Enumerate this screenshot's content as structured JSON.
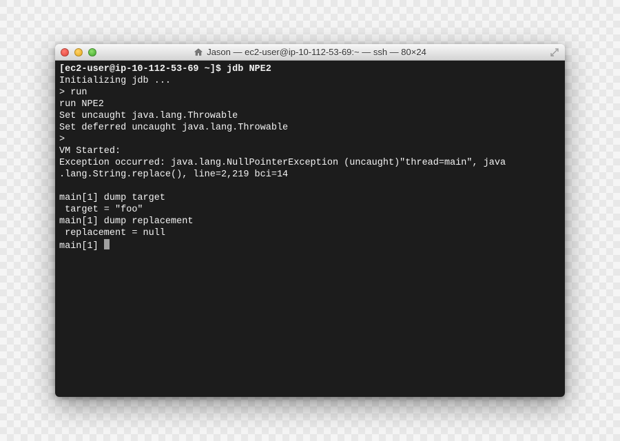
{
  "window": {
    "title": "Jason — ec2-user@ip-10-112-53-69:~ — ssh — 80×24"
  },
  "terminal": {
    "l1_prompt": "[ec2-user@ip-10-112-53-69 ~]$ ",
    "l1_cmd": "jdb NPE2",
    "l2": "Initializing jdb ...",
    "l3": "> run",
    "l4": "run NPE2",
    "l5": "Set uncaught java.lang.Throwable",
    "l6": "Set deferred uncaught java.lang.Throwable",
    "l7": "> ",
    "l8": "VM Started: ",
    "l9": "Exception occurred: java.lang.NullPointerException (uncaught)\"thread=main\", java",
    "l10": ".lang.String.replace(), line=2,219 bci=14",
    "l11": "",
    "l12": "main[1] dump target",
    "l13": " target = \"foo\"",
    "l14": "main[1] dump replacement",
    "l15": " replacement = null",
    "l16": "main[1] "
  }
}
